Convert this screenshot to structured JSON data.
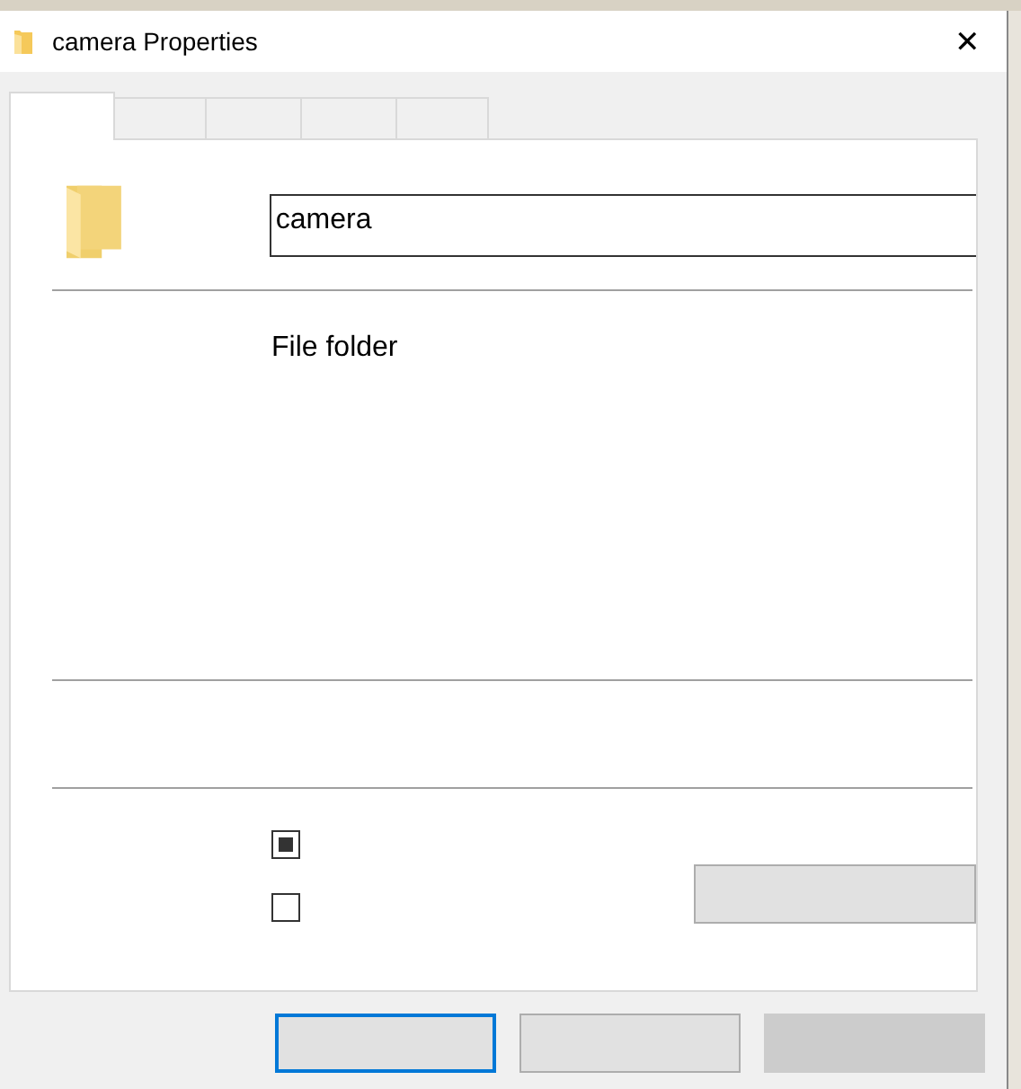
{
  "window": {
    "title": "camera Properties",
    "close_glyph": "✕"
  },
  "tabs": [
    {
      "selected": true
    },
    {
      "selected": false
    },
    {
      "selected": false
    },
    {
      "selected": false
    },
    {
      "selected": false
    }
  ],
  "name_field": {
    "value": "camera"
  },
  "type_text": "File folder",
  "checkboxes": [
    {
      "checked": true
    },
    {
      "checked": false
    }
  ],
  "side_button": {
    "disabled": false
  },
  "buttons": [
    {
      "focused": true,
      "disabled": false
    },
    {
      "focused": false,
      "disabled": false
    },
    {
      "focused": false,
      "disabled": true
    }
  ]
}
